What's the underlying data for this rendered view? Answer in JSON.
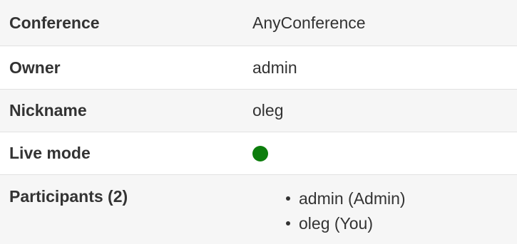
{
  "rows": {
    "conference": {
      "label": "Conference",
      "value": "AnyConference"
    },
    "owner": {
      "label": "Owner",
      "value": "admin"
    },
    "nickname": {
      "label": "Nickname",
      "value": "oleg"
    },
    "live_mode": {
      "label": "Live mode",
      "status": "active",
      "status_color": "#0c7d0c"
    },
    "participants": {
      "label": "Participants (2)",
      "items": [
        "admin (Admin)",
        "oleg (You)"
      ]
    }
  },
  "colors": {
    "stripe": "#f6f6f6",
    "border": "#e2e2e2",
    "text": "#333333",
    "live_indicator": "#0c7d0c"
  }
}
